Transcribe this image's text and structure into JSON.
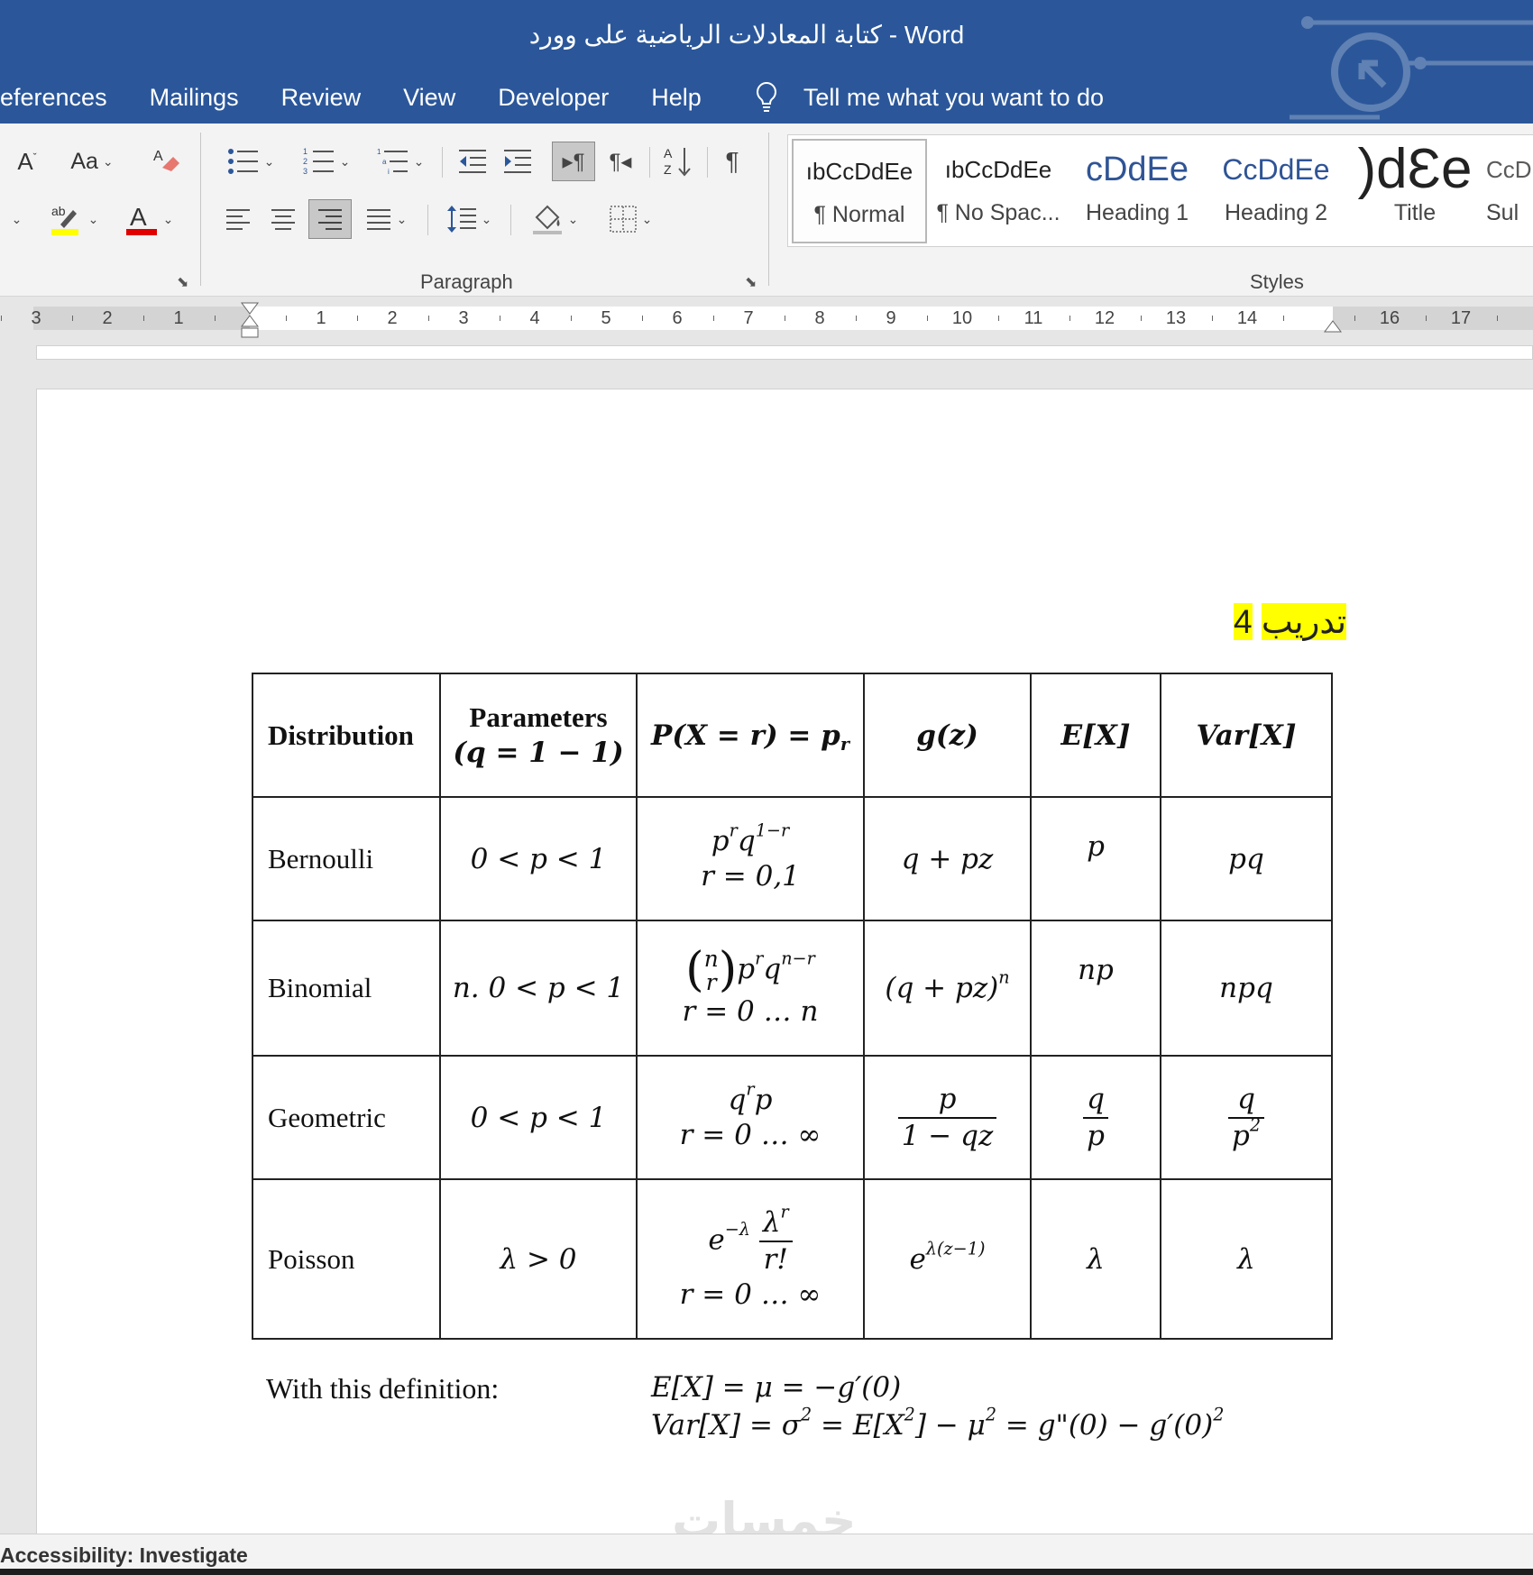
{
  "window": {
    "title": "كتابة المعادلات الرياضية على وورد  -  Word"
  },
  "menu": {
    "items": [
      "eferences",
      "Mailings",
      "Review",
      "View",
      "Developer",
      "Help"
    ],
    "tell_me": "Tell me what you want to do"
  },
  "ribbon": {
    "paragraph_label": "Paragraph",
    "styles_label": "Styles",
    "font_size_icon_text": "Aa",
    "styles": [
      {
        "sample": "ıbCcDdEe",
        "name": "¶ Normal"
      },
      {
        "sample": "ıbCcDdEe",
        "name": "¶ No Spac..."
      },
      {
        "sample": "cDdEe",
        "name": "Heading 1"
      },
      {
        "sample": "CcDdEe",
        "name": "Heading 2"
      },
      {
        "sample": ")dƐe",
        "name": "Title"
      },
      {
        "sample": "CcD",
        "name": "Sul"
      }
    ],
    "colors": {
      "highlight": "#ffff00",
      "font_color": "#e00000",
      "accent": "#2b579a"
    }
  },
  "ruler": {
    "labels": [
      "3",
      "2",
      "1",
      "1",
      "2",
      "3",
      "4",
      "5",
      "6",
      "7",
      "8",
      "9",
      "10",
      "11",
      "12",
      "13",
      "14",
      "16",
      "17"
    ]
  },
  "document": {
    "exercise": {
      "text": "تدريب",
      "number": "4"
    },
    "table": {
      "headers": {
        "distribution": "Distribution",
        "parameters_l1": "Parameters",
        "parameters_l2": "(q = 1 − 1)",
        "pmf": "P(X = r) = p",
        "pmf_sub": "r",
        "gz": "g(z)",
        "ex": "E[X]",
        "var": "Var[X]"
      },
      "rows": {
        "bernoulli": {
          "name": "Bernoulli",
          "params": "0 < p < 1",
          "pmf_base1": "p",
          "pmf_exp1": "r",
          "pmf_base2": "q",
          "pmf_exp2": "1−r",
          "pmf_range": "r = 0,1",
          "gz": "q + pz",
          "ex": "p",
          "var": "pq"
        },
        "binomial": {
          "name": "Binomial",
          "params": "n. 0 < p < 1",
          "binom_top": "n",
          "binom_bottom": "r",
          "pmf_base1": "p",
          "pmf_exp1": "r",
          "pmf_base2": "q",
          "pmf_exp2": "n−r",
          "pmf_range": "r = 0 … n",
          "gz": "(q + pz)",
          "gz_exp": "n",
          "ex": "np",
          "var": "npq"
        },
        "geometric": {
          "name": "Geometric",
          "params": "0 < p < 1",
          "pmf_base1": "q",
          "pmf_exp1": "r",
          "pmf_tail": "p",
          "pmf_range": "r = 0 … ∞",
          "gz_num": "p",
          "gz_den": "1 − qz",
          "ex_num": "q",
          "ex_den": "p",
          "var_num": "q",
          "var_den": "p",
          "var_den_exp": "2"
        },
        "poisson": {
          "name": "Poisson",
          "params": "λ > 0",
          "pmf_e": "e",
          "pmf_e_exp": "−λ",
          "pmf_num": "λ",
          "pmf_num_exp": "r",
          "pmf_den": "r!",
          "pmf_range": "r = 0 … ∞",
          "gz": "e",
          "gz_exp": "λ(z−1)",
          "ex": "λ",
          "var": "λ"
        }
      }
    },
    "definition": {
      "label": "With this definition:",
      "line1": "E[X] = μ = −g′(0)",
      "line2_a": "Var[X] = σ",
      "line2_a_exp": "2",
      "line2_b": " = E[X",
      "line2_b_exp": "2",
      "line2_c": "] − μ",
      "line2_c_exp": "2",
      "line2_d": " = g\"(0) − g′(0)",
      "line2_d_exp": "2"
    }
  },
  "status": {
    "accessibility": "Accessibility: Investigate"
  },
  "watermark": "خمسات"
}
